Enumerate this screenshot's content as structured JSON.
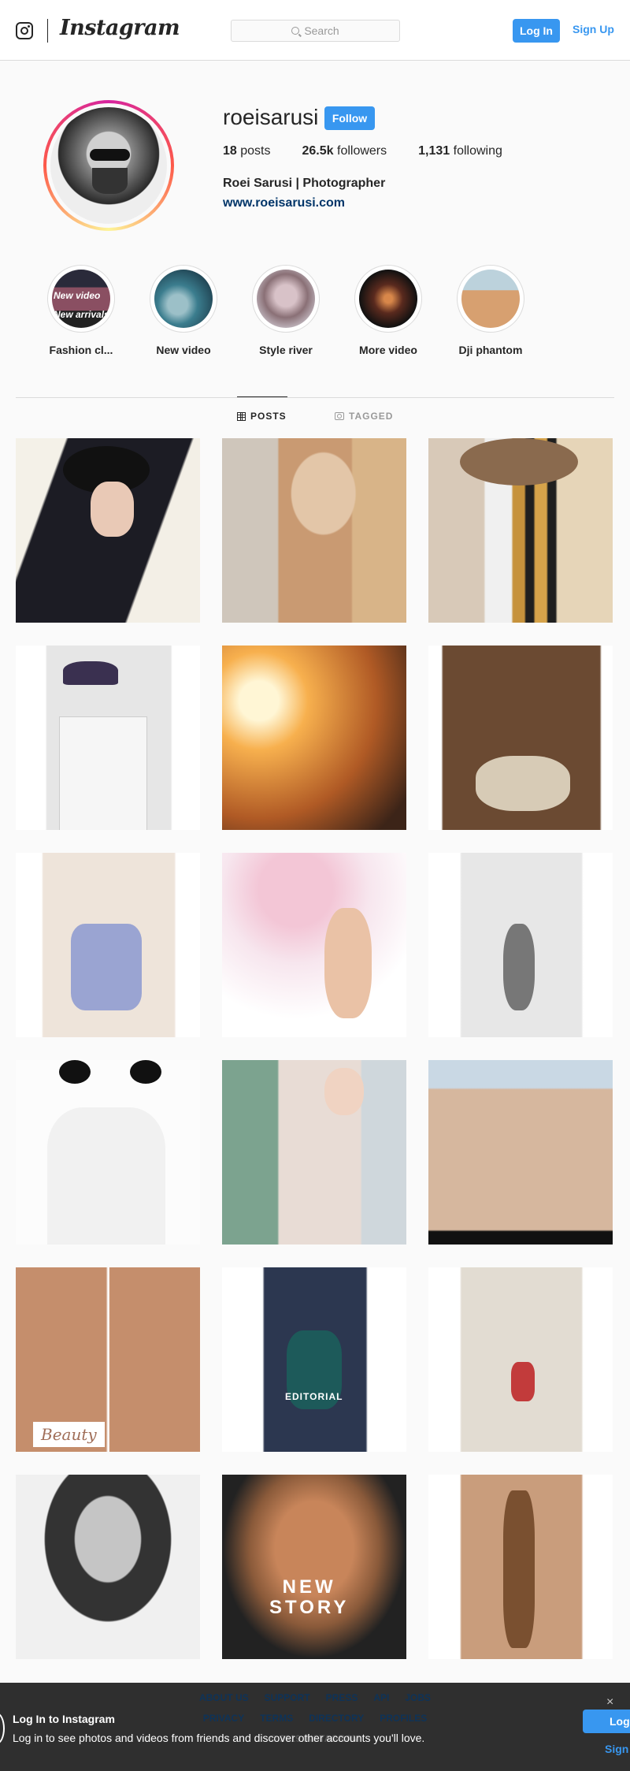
{
  "nav": {
    "brand": "Instagram",
    "search_placeholder": "Search",
    "login_label": "Log In",
    "signup_label": "Sign Up",
    "icons": [
      "instagram-glyph-icon",
      "search-icon"
    ]
  },
  "profile": {
    "username": "roeisarusi",
    "follow_label": "Follow",
    "posts_count": "18",
    "posts_label": "posts",
    "followers_count": "26.5k",
    "followers_label": "followers",
    "following_count": "1,131",
    "following_label": "following",
    "full_name": "Roei Sarusi | Photographer",
    "website": "www.roeisarusi.com"
  },
  "highlights": [
    {
      "label": "Fashion cl...",
      "badge_top": "New video",
      "badge_bottom": "New arrivals"
    },
    {
      "label": "New video"
    },
    {
      "label": "Style river"
    },
    {
      "label": "More video"
    },
    {
      "label": "Dji phantom"
    }
  ],
  "tabs": {
    "posts_label": "POSTS",
    "tagged_label": "TAGGED",
    "active": "POSTS"
  },
  "posts": [
    {
      "overlay": ""
    },
    {
      "overlay": ""
    },
    {
      "overlay": ""
    },
    {
      "overlay": ""
    },
    {
      "overlay": ""
    },
    {
      "overlay": ""
    },
    {
      "overlay": ""
    },
    {
      "overlay": ""
    },
    {
      "overlay": ""
    },
    {
      "overlay": ""
    },
    {
      "overlay": ""
    },
    {
      "overlay": ""
    },
    {
      "overlay": "Beauty"
    },
    {
      "overlay": "EDITORIAL"
    },
    {
      "overlay": ""
    },
    {
      "overlay": ""
    },
    {
      "overlay": "NEW STORY"
    },
    {
      "overlay": ""
    }
  ],
  "footer": {
    "links_row1": [
      "ABOUT US",
      "SUPPORT",
      "PRESS",
      "API",
      "JOBS"
    ],
    "links_row2": [
      "PRIVACY",
      "TERMS",
      "DIRECTORY",
      "PROFILES"
    ],
    "copyright": "© 2019 INSTAGRAM"
  },
  "login_banner": {
    "title": "Log In to Instagram",
    "body": "Log in to see photos and videos from friends and discover other accounts you'll love.",
    "login_label": "Log",
    "signup_label": "Sign",
    "close_glyph": "×"
  },
  "colors": {
    "accent": "#3897f0",
    "link": "#003569",
    "text": "#262626",
    "border": "#dbdbdb",
    "background": "#fafafa"
  }
}
